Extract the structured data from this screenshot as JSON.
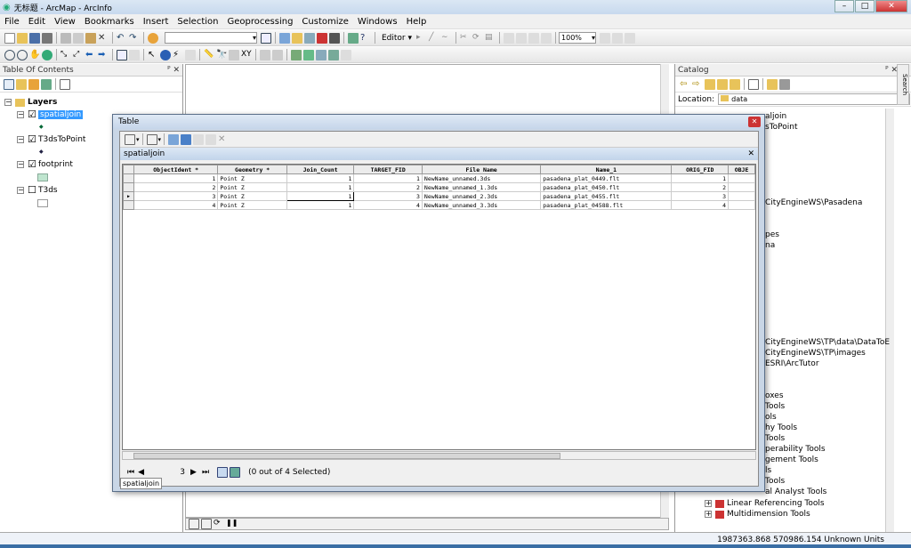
{
  "window": {
    "title": "无标题 - ArcMap - ArcInfo"
  },
  "menu": [
    "File",
    "Edit",
    "View",
    "Bookmarks",
    "Insert",
    "Selection",
    "Geoprocessing",
    "Customize",
    "Windows",
    "Help"
  ],
  "toolbar": {
    "scale_value": "",
    "editor_label": "Editor ▾",
    "zoom_value": "100%"
  },
  "toc": {
    "title": "Table Of Contents",
    "root": "Layers",
    "layers": [
      {
        "name": "spatialjoin",
        "checked": "☑",
        "selected": true
      },
      {
        "name": "T3dsToPoint",
        "checked": "☑"
      },
      {
        "name": "footprint",
        "checked": "☑"
      },
      {
        "name": "T3ds",
        "checked": "☐"
      }
    ]
  },
  "catalog": {
    "title": "Catalog",
    "location_label": "Location:",
    "location_value": "data",
    "search_tab": "Search",
    "items": [
      "aljoin",
      "sToPoint",
      "CityEngineWS\\Pasadena",
      "pes",
      "na",
      "CityEngineWS\\TP\\data\\DataToE",
      "CityEngineWS\\TP\\images",
      "ESRI\\ArcTutor",
      "oxes",
      "Tools",
      "ols",
      "hy Tools",
      "Tools",
      "perability Tools",
      "gement Tools",
      "ls",
      "Tools",
      "al Analyst Tools",
      "Linear Referencing Tools",
      "Multidimension Tools"
    ]
  },
  "table": {
    "window_title": "Table",
    "tab_label": "spatialjoin",
    "tab_button": "spatialjoin",
    "columns": [
      "ObjectIdent *",
      "Geometry *",
      "Join_Count",
      "TARGET_FID",
      "File Name",
      "Name_1",
      "ORIG_FID",
      "OBJE"
    ],
    "rows": [
      [
        "1",
        "Point Z",
        "1",
        "1",
        "NewName_unnamed.3ds",
        "pasadena_plat_0449.flt",
        "1",
        ""
      ],
      [
        "2",
        "Point Z",
        "1",
        "2",
        "NewName_unnamed_1.3ds",
        "pasadena_plat_0450.flt",
        "2",
        ""
      ],
      [
        "3",
        "Point Z",
        "1",
        "3",
        "NewName_unnamed_2.3ds",
        "pasadena_plat_0455.flt",
        "3",
        ""
      ],
      [
        "4",
        "Point Z",
        "1",
        "4",
        "NewName_unnamed_3.3ds",
        "pasadena_plat_04588.flt",
        "4",
        ""
      ]
    ],
    "current_record": "3",
    "selection_status": "(0 out of 4 Selected)"
  },
  "status": {
    "coords": "1987363.868  570986.154 Unknown Units"
  },
  "colors": {
    "title_bg": "#c7d9ee",
    "selected_layer": "#3399ff"
  }
}
